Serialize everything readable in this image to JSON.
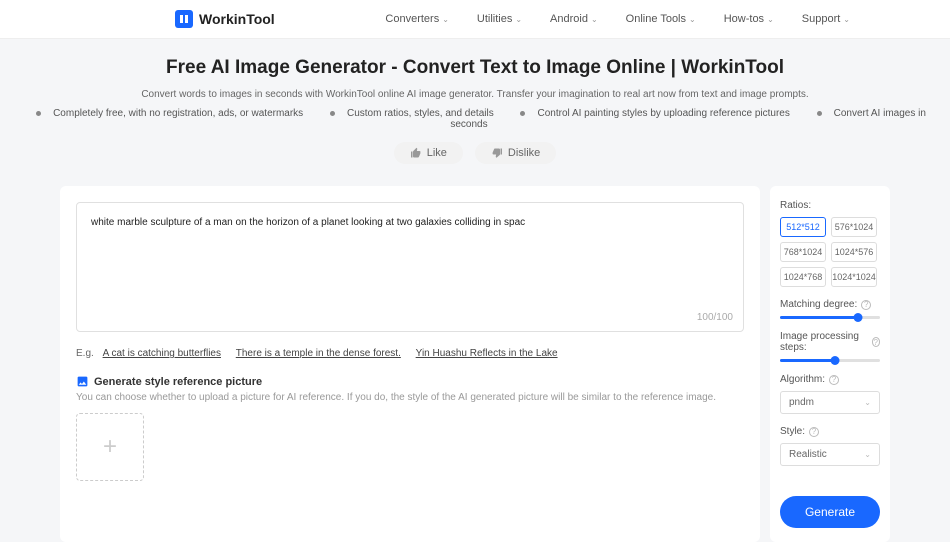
{
  "brand": "WorkinTool",
  "nav": [
    "Converters",
    "Utilities",
    "Android",
    "Online Tools",
    "How-tos",
    "Support"
  ],
  "hero": {
    "title": "Free AI Image Generator - Convert Text to Image Online | WorkinTool",
    "subtitle": "Convert words to images in seconds with WorkinTool online AI image generator. Transfer your imagination to real art now from text and image prompts.",
    "features": [
      "Completely free, with no registration, ads, or watermarks",
      "Custom ratios, styles, and details",
      "Control AI painting styles by uploading reference pictures",
      "Convert AI images in seconds"
    ]
  },
  "feedback": {
    "like": "Like",
    "dislike": "Dislike"
  },
  "prompt": {
    "text": "white marble sculpture of a man on the horizon of a planet looking at two galaxies colliding in spac",
    "counter": "100/100"
  },
  "examples": {
    "prefix": "E.g.",
    "items": [
      "A cat is catching butterflies",
      "There is a temple in the dense forest.",
      "Yin Huashu Reflects in the Lake"
    ]
  },
  "reference": {
    "title": "Generate style reference picture",
    "desc": "You can choose whether to upload a picture for AI reference. If you do, the style of the AI generated picture will be similar to the reference image."
  },
  "sidebar": {
    "ratios_label": "Ratios:",
    "ratios": [
      "512*512",
      "576*1024",
      "768*1024",
      "1024*576",
      "1024*768",
      "1024*1024"
    ],
    "matching_label": "Matching degree:",
    "steps_label": "Image processing steps:",
    "algorithm_label": "Algorithm:",
    "algorithm_value": "pndm",
    "style_label": "Style:",
    "style_value": "Realistic",
    "generate": "Generate"
  }
}
